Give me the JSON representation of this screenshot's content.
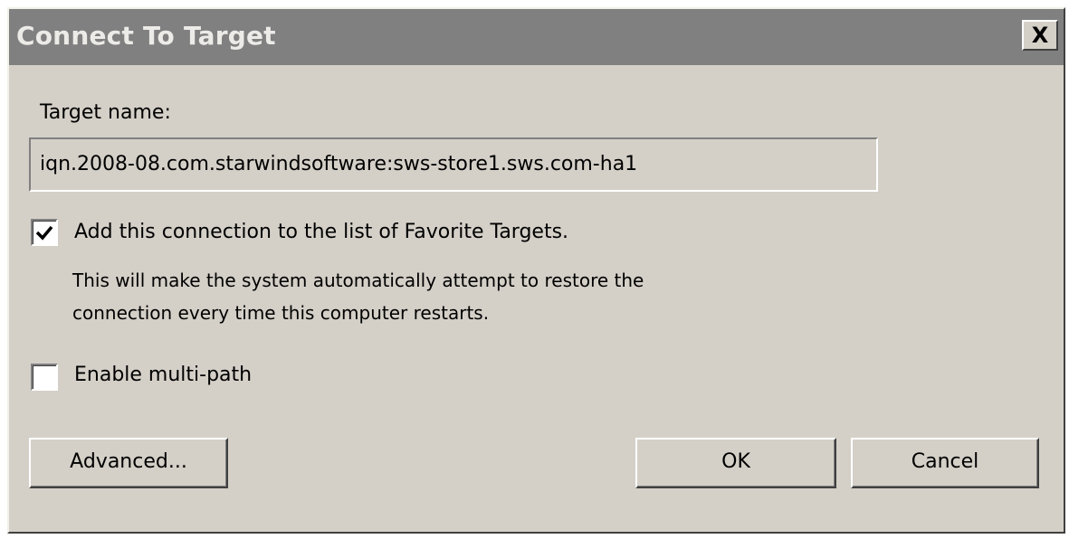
{
  "dialog": {
    "title": "Connect To Target",
    "close_label": "X"
  },
  "target": {
    "label": "Target name:",
    "value": "iqn.2008-08.com.starwindsoftware:sws-store1.sws.com-ha1"
  },
  "favorites": {
    "checked": true,
    "label": "Add this connection to the list of Favorite Targets.",
    "description": "This will make the system automatically attempt to restore the\nconnection every time this computer restarts."
  },
  "multipath": {
    "checked": false,
    "label": "Enable multi-path"
  },
  "buttons": {
    "advanced": "Advanced...",
    "ok": "OK",
    "cancel": "Cancel"
  },
  "colors": {
    "dialog_bg": "#d4d0c8",
    "titlebar_bg": "#808080",
    "title_text": "#ecebe8"
  },
  "icons": {
    "close": "close-icon",
    "check": "check-icon"
  }
}
